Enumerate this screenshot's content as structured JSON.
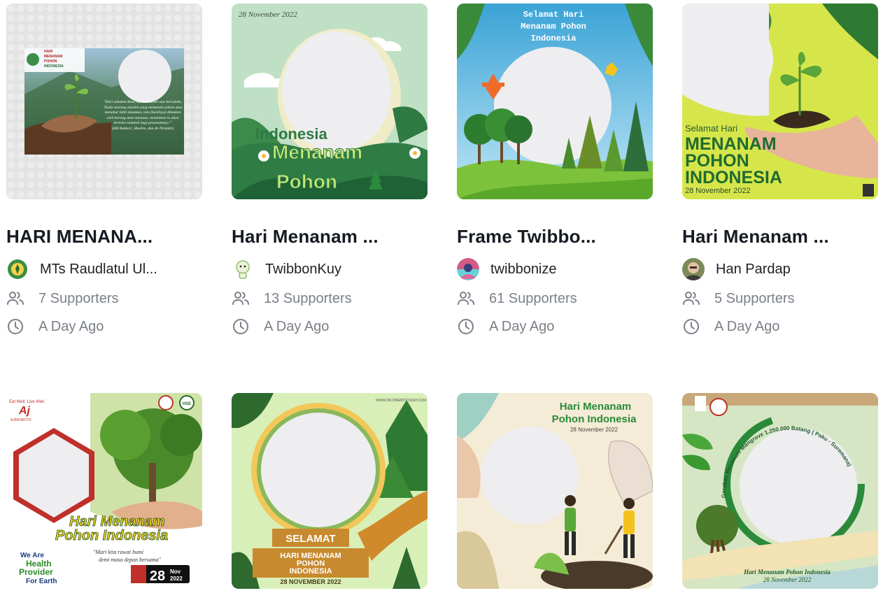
{
  "cards": [
    {
      "title": "HARI MENANA...",
      "creator": "MTs Raudlatul Ul...",
      "supporters": "7 Supporters",
      "time": "A Day Ago",
      "thumb": {
        "header": [
          "HARI",
          "MENANAM",
          "POHON",
          "INDONESIA"
        ],
        "quote": "\"Dari sahabat Anas ra, Rasulullah saw bersabda, 'Tiada seorang muslim yang menanam pohon atau menabur bibit tanaman, lalu (hasilnya) dimakan oleh burung atau manusia, melainkan ia akan bernilai sedekah bagi penanamnya.'\"",
        "source": "(HR Bukhari, Muslim, dan At-Tirmidzi)"
      }
    },
    {
      "title": "Hari Menanam ...",
      "creator": "TwibbonKuy",
      "supporters": "13 Supporters",
      "time": "A Day Ago",
      "thumb": {
        "date": "28 November 2022",
        "line1": "Indonesia",
        "line2": "Menanam",
        "line3": "Pohon"
      }
    },
    {
      "title": "Frame Twibbo...",
      "creator": "twibbonize",
      "supporters": "61 Supporters",
      "time": "A Day Ago",
      "thumb": {
        "line1": "Selamat Hari",
        "line2": "Menanam Pohon",
        "line3": "Indonesia"
      }
    },
    {
      "title": "Hari Menanam ...",
      "creator": "Han Pardap",
      "supporters": "5 Supporters",
      "time": "A Day Ago",
      "thumb": {
        "line1": "Selamat Hari",
        "line2": "MENANAM",
        "line3": "POHON",
        "line4": "INDONESIA",
        "date": "28 November 2022"
      }
    },
    {
      "thumb": {
        "tagline": "Eat Well, Live Well.",
        "brand": "AJINOMOTO",
        "line1": "Hari Menanam",
        "line2": "Pohon Indonesia",
        "quote1": "\"Mari kita rawat bumi",
        "quote2": "demi masa depan bersama\"",
        "health1": "We Are",
        "health2": "Health",
        "health3": "Provider",
        "health4": "For Earth",
        "day": "28",
        "month": "Nov",
        "year": "2022",
        "badge": "HSE"
      }
    },
    {
      "thumb": {
        "url": "WWW.INCOMEBITTODAY.COM",
        "line1": "SELAMAT",
        "line2": "HARI MENANAM",
        "line3": "POHON",
        "line4": "INDONESIA",
        "date": "28 NOVEMBER 2022"
      }
    },
    {
      "thumb": {
        "line1": "Hari Menanam",
        "line2": "Pohon Indonesia",
        "date": "28 November 2022"
      }
    },
    {
      "thumb": {
        "arc": "Gerakan Menanam Mangrove 1.250.000 Batang ( Paku - Suremana)",
        "line1": "Hari Menanam Pohon Indonesia",
        "date": "28 November 2022"
      }
    }
  ],
  "colors": {
    "title": "#161a22",
    "muted": "#7a7f88",
    "placeholder": "#eeeef0"
  }
}
